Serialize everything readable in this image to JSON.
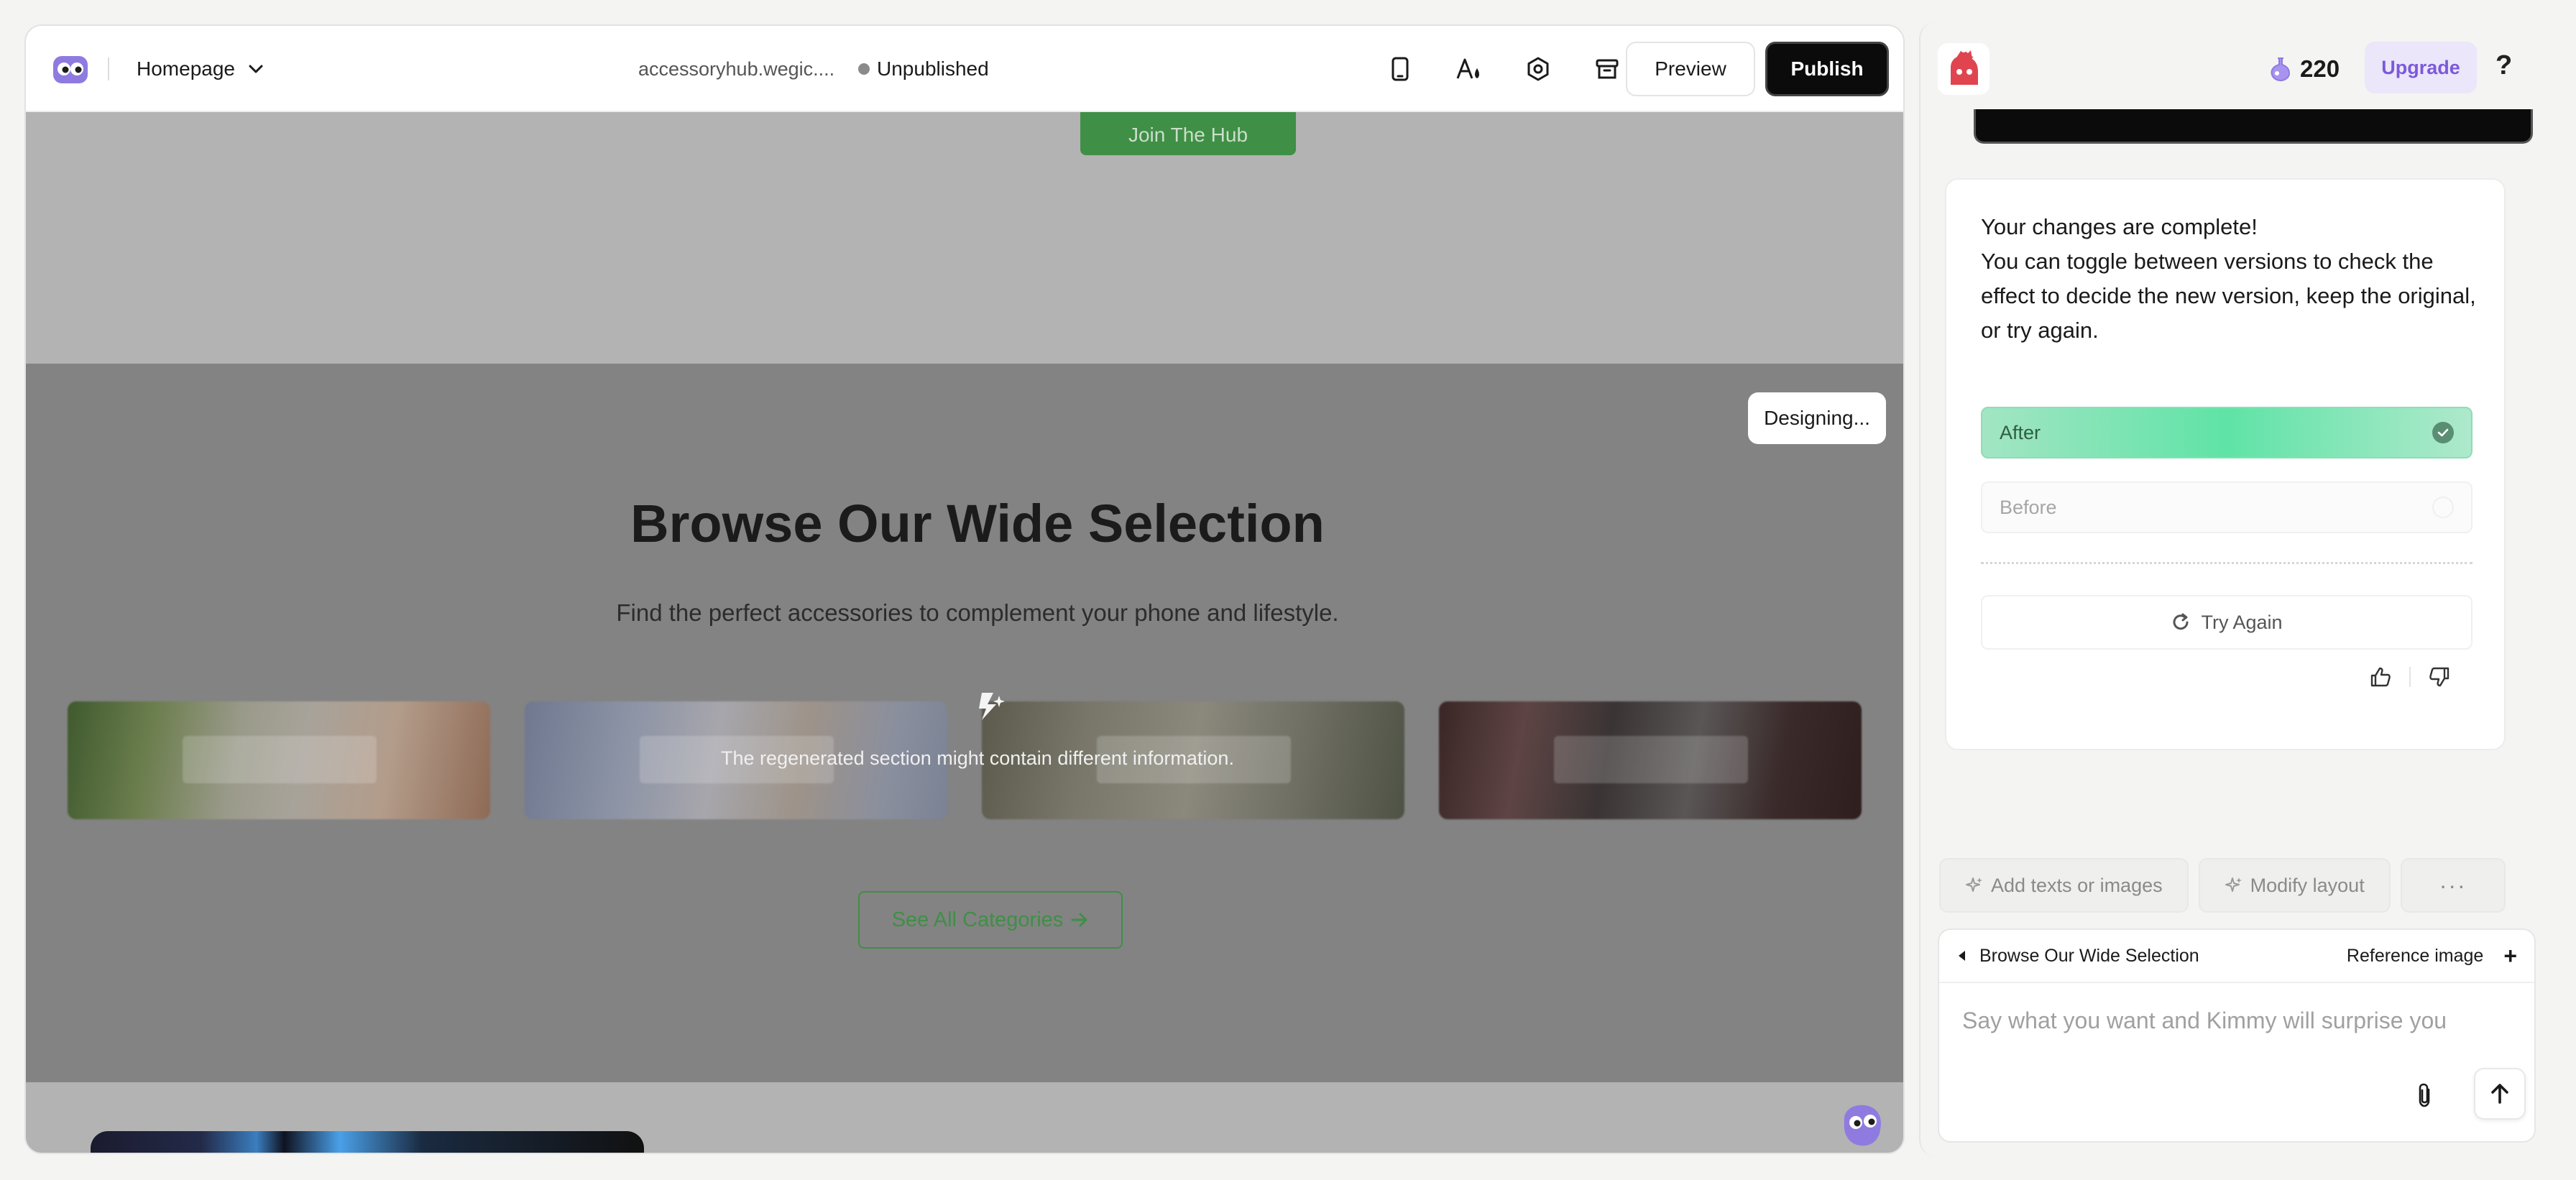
{
  "topbar": {
    "page_name": "Homepage",
    "domain": "accessoryhub.wegic....",
    "status": "Unpublished",
    "preview_label": "Preview",
    "publish_label": "Publish",
    "icons": [
      "mobile-device-icon",
      "font-style-icon",
      "settings-gear-icon",
      "archive-icon"
    ]
  },
  "canvas": {
    "hero_button": "Join The Hub",
    "designing_badge": "Designing...",
    "section_title": "Browse Our Wide Selection",
    "section_subtitle": "Find the perfect accessories to complement your phone and lifestyle.",
    "regen_notice": "The regenerated section might contain different information.",
    "see_all_label": "See All Categories",
    "accent_color": "#3f8f46"
  },
  "chat": {
    "credits": "220",
    "upgrade_label": "Upgrade",
    "help_label": "?",
    "message_line1": "Your changes are complete!",
    "message_line2": "You can toggle between versions to check the effect to decide the new version, keep the original, or try again.",
    "version_after": "After",
    "version_before": "Before",
    "selected_version": "After",
    "try_again_label": "Try Again",
    "chips": {
      "add_texts": "Add texts or images",
      "modify_layout": "Modify layout",
      "more": "···"
    },
    "composer": {
      "selected_section": "Browse Our Wide Selection",
      "reference_label": "Reference image",
      "add_symbol": "+",
      "placeholder": "Say what you want and Kimmy will surprise you"
    }
  }
}
